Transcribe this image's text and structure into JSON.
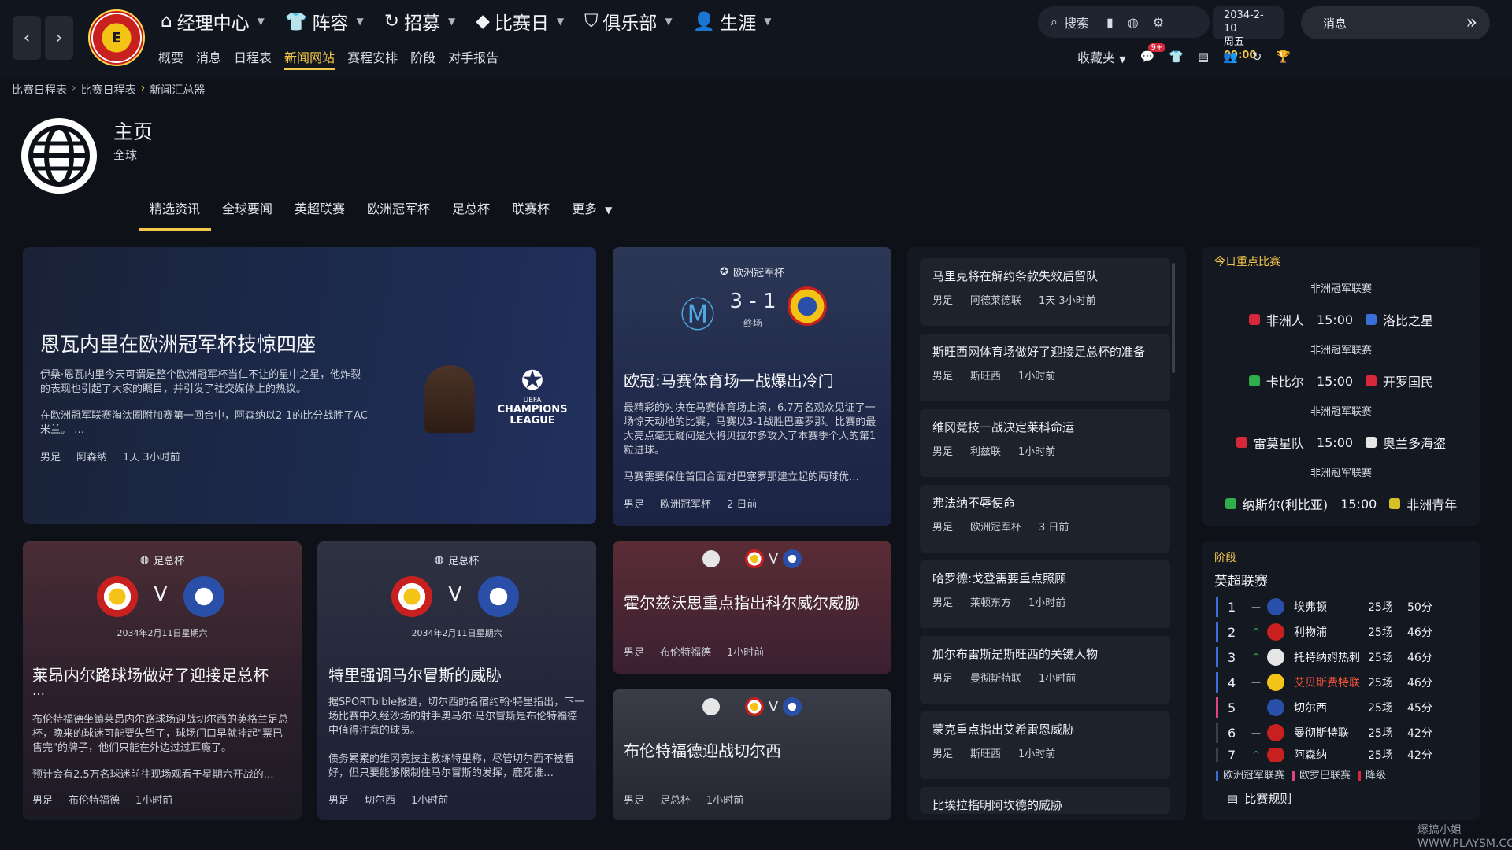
{
  "topnav": {
    "items": [
      {
        "label": "经理中心",
        "icon": "home-icon"
      },
      {
        "label": "阵容",
        "icon": "shirt-icon"
      },
      {
        "label": "招募",
        "icon": "refresh-icon"
      },
      {
        "label": "比赛日",
        "icon": "diamond-icon"
      },
      {
        "label": "俱乐部",
        "icon": "shield-icon"
      },
      {
        "label": "生涯",
        "icon": "person-icon"
      }
    ],
    "subitems": [
      "概要",
      "消息",
      "日程表",
      "新闻网站",
      "赛程安排",
      "阶段",
      "对手报告"
    ],
    "active_sub": "新闻网站",
    "search_label": "搜索",
    "date": "2034-2-10",
    "weekday": "周五",
    "time": "09:00",
    "messages_label": "消息",
    "favorites_label": "收藏夹",
    "notification_count": "9+"
  },
  "breadcrumb": [
    "比赛日程表",
    "比赛日程表",
    "新闻汇总器"
  ],
  "header": {
    "title": "主页",
    "subtitle": "全球"
  },
  "tabs": [
    "精选资讯",
    "全球要闻",
    "英超联赛",
    "欧洲冠军杯",
    "足总杯",
    "联赛杯",
    "更多"
  ],
  "feature": {
    "title": "恩瓦内里在欧洲冠军杯技惊四座",
    "para1": "伊桑·恩瓦内里今天可谓是整个欧洲冠军杯当仁不让的星中之星，他炸裂的表现也引起了大家的瞩目，并引发了社交媒体上的热议。",
    "para2": "在欧洲冠军联赛淘汰圈附加赛第一回合中，阿森纳以2-1的比分战胜了AC米兰。 …",
    "tags": [
      "男足",
      "阿森纳",
      "1天 3小时前"
    ],
    "logo_text": "CHAMPIONS LEAGUE",
    "logo_small": "UEFA"
  },
  "match_card": {
    "competition": "欧洲冠军杯",
    "score": "3 - 1",
    "status": "终场",
    "title": "欧冠:马赛体育场一战爆出冷门",
    "para1": "最精彩的对决在马赛体育场上演，6.7万名观众见证了一场惊天动地的比赛，马赛以3-1战胜巴塞罗那。比赛的最大亮点毫无疑问是大将贝拉尔多攻入了本赛季个人的第1粒进球。",
    "para2": "马赛需要保住首回合面对巴塞罗那建立起的两球优…",
    "tags": [
      "男足",
      "欧洲冠军杯",
      "2 日前"
    ]
  },
  "cup_cards": [
    {
      "competition": "足总杯",
      "date": "2034年2月11日星期六",
      "vs": "V",
      "title": "莱昂内尔路球场做好了迎接足总杯",
      "title2": "…",
      "para1": "布伦特福德坐镇莱昂内尔路球场迎战切尔西的英格兰足总杯，晚来的球迷可能要失望了，球场门口早就挂起\"票已售完\"的牌子，他们只能在外边过过耳瘾了。",
      "para2": "预计会有2.5万名球迷前往现场观看于星期六开战的…",
      "tags": [
        "男足",
        "布伦特福德",
        "1小时前"
      ]
    },
    {
      "competition": "足总杯",
      "date": "2034年2月11日星期六",
      "vs": "V",
      "title": "特里强调马尔冒斯的威胁",
      "para1": "据SPORTbible报道，切尔西的名宿约翰·特里指出，下一场比赛中久经沙场的射手奥马尔·马尔冒斯是布伦特福德中值得注意的球员。",
      "para2": "债务累累的维冈竞技主教练特里称，尽管切尔西不被看好，但只要能够限制住马尔冒斯的发挥，鹿死谁…",
      "tags": [
        "男足",
        "切尔西",
        "1小时前"
      ]
    }
  ],
  "small_cards": [
    {
      "vs": "V",
      "title": "霍尔兹沃思重点指出科尔威尔威胁",
      "tags": [
        "男足",
        "布伦特福德",
        "1小时前"
      ]
    },
    {
      "vs": "V",
      "title": "布伦特福德迎战切尔西",
      "tags": [
        "男足",
        "足总杯",
        "1小时前"
      ]
    }
  ],
  "news_list": [
    {
      "title": "马里克将在解约条款失效后留队",
      "tags": [
        "男足",
        "阿德莱德联",
        "1天 3小时前"
      ]
    },
    {
      "title": "斯旺西网体育场做好了迎接足总杯的准备",
      "tags": [
        "男足",
        "斯旺西",
        "1小时前"
      ]
    },
    {
      "title": "维冈竞技一战决定莱科命运",
      "tags": [
        "男足",
        "利兹联",
        "1小时前"
      ]
    },
    {
      "title": "弗法纳不辱使命",
      "tags": [
        "男足",
        "欧洲冠军杯",
        "3 日前"
      ]
    },
    {
      "title": "哈罗德:戈登需要重点照顾",
      "tags": [
        "男足",
        "莱顿东方",
        "1小时前"
      ]
    },
    {
      "title": "加尔布雷斯是斯旺西的关键人物",
      "tags": [
        "男足",
        "曼彻斯特联",
        "1小时前"
      ]
    },
    {
      "title": "蒙克重点指出艾希雷恩威胁",
      "tags": [
        "男足",
        "斯旺西",
        "1小时前"
      ]
    },
    {
      "title": "比埃拉指明阿坎德的威胁",
      "tags": []
    }
  ],
  "fixtures": {
    "heading": "今日重点比赛",
    "items": [
      {
        "competition": "非洲冠军联赛",
        "home": "非洲人",
        "time": "15:00",
        "away": "洛比之星",
        "home_color": "#d6283a",
        "away_color": "#3a6fd8"
      },
      {
        "competition": "非洲冠军联赛",
        "home": "卡比尔",
        "time": "15:00",
        "away": "开罗国民",
        "home_color": "#2fae4a",
        "away_color": "#d6283a"
      },
      {
        "competition": "非洲冠军联赛",
        "home": "雷莫星队",
        "time": "15:00",
        "away": "奥兰多海盗",
        "home_color": "#d6283a",
        "away_color": "#e6e6e6"
      },
      {
        "competition": "非洲冠军联赛",
        "home": "纳斯尔(利比亚)",
        "time": "15:00",
        "away": "非洲青年",
        "home_color": "#2fae4a",
        "away_color": "#d6c02a"
      }
    ]
  },
  "table": {
    "heading": "阶段",
    "league": "英超联赛",
    "rows": [
      {
        "pos": "1",
        "move": "—",
        "team": "埃弗顿",
        "played": "25场",
        "points": "50分",
        "bar": "#3a6fd8",
        "crest": "#2a4fa8",
        "highlight": false
      },
      {
        "pos": "2",
        "move": "^",
        "team": "利物浦",
        "played": "25场",
        "points": "46分",
        "bar": "#3a6fd8",
        "crest": "#c8201e",
        "highlight": false
      },
      {
        "pos": "3",
        "move": "^",
        "team": "托特纳姆热刺",
        "played": "25场",
        "points": "46分",
        "bar": "#3a6fd8",
        "crest": "#e6e6e6",
        "highlight": false
      },
      {
        "pos": "4",
        "move": "—",
        "team": "艾贝斯费特联",
        "played": "25场",
        "points": "46分",
        "bar": "#3a6fd8",
        "crest": "#f3c316",
        "highlight": true
      },
      {
        "pos": "5",
        "move": "—",
        "team": "切尔西",
        "played": "25场",
        "points": "45分",
        "bar": "#e0457b",
        "crest": "#2a4fa8",
        "highlight": false
      },
      {
        "pos": "6",
        "move": "—",
        "team": "曼彻斯特联",
        "played": "25场",
        "points": "42分",
        "bar": "#c9ced8",
        "crest": "#c8201e",
        "highlight": false
      },
      {
        "pos": "7",
        "move": "^",
        "team": "阿森纳",
        "played": "25场",
        "points": "42分",
        "bar": "#c9ced8",
        "crest": "#c8201e",
        "highlight": false
      }
    ],
    "legend": [
      {
        "label": "欧洲冠军联赛",
        "color": "#3a6fd8"
      },
      {
        "label": "欧罗巴联赛",
        "color": "#e0457b"
      },
      {
        "label": "降级",
        "color": "#d6283a"
      }
    ],
    "rules_label": "比赛规则"
  },
  "watermark": "爆搞小姐 WWW.PLAYSM.CC",
  "colors": {
    "accent": "#f4c84a",
    "bg": "#0e1118",
    "card": "#1d222c"
  }
}
